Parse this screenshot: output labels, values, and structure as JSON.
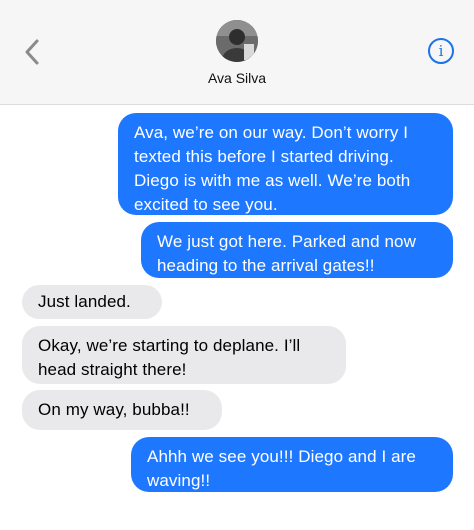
{
  "header": {
    "back_icon": "chevron-left-icon",
    "contact_name": "Ava Silva",
    "info_icon": "info-icon",
    "info_glyph": "i",
    "accent_color": "#1a73e8"
  },
  "messages": [
    {
      "direction": "sent",
      "text": "Ava, we’re on our way. Don’t worry I texted this before I started driving. Diego is with me as well. We’re both excited to see you."
    },
    {
      "direction": "sent",
      "text": "We just got here. Parked and now heading to the arrival gates!!"
    },
    {
      "direction": "received",
      "text": "Just landed."
    },
    {
      "direction": "received",
      "text": "Okay, we’re starting to deplane. I’ll head straight there!"
    },
    {
      "direction": "received",
      "text": "On my way, bubba!!"
    },
    {
      "direction": "sent",
      "text": "Ahhh we see you!!! Diego and I are waving!!"
    }
  ],
  "colors": {
    "sent_bubble": "#1e78ff",
    "received_bubble": "#e9e9eb"
  }
}
